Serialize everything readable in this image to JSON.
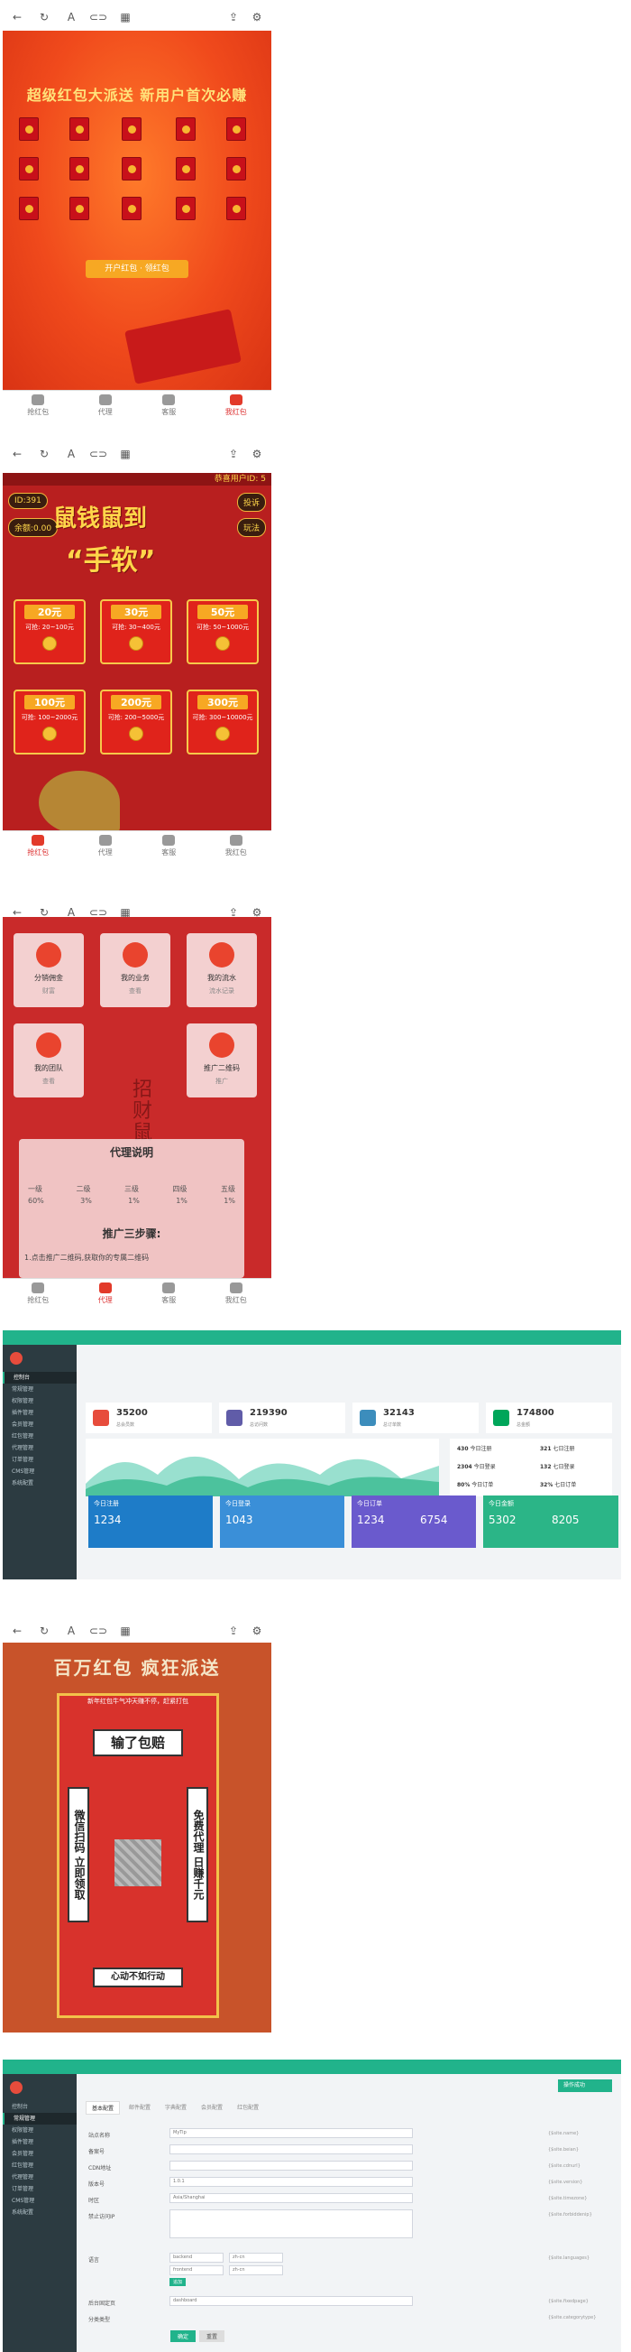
{
  "screen1": {
    "headline": "超级红包大派送 新用户首次必赚",
    "cta": "开户红包 · 领红包",
    "tabs": [
      "抢红包",
      "代理",
      "客服",
      "我红包"
    ]
  },
  "screen2": {
    "user_id": "ID:391",
    "balance": "余额:0.00",
    "notice": "恭喜用户ID: 5",
    "top_right_1": "投诉",
    "top_right_2": "玩法",
    "banner_title": "鼠钱鼠到",
    "banner_sub": "“手软”",
    "prizes": [
      {
        "amount": "20元",
        "range": "可抢: 20~100元"
      },
      {
        "amount": "30元",
        "range": "可抢: 30~400元"
      },
      {
        "amount": "50元",
        "range": "可抢: 50~1000元"
      },
      {
        "amount": "100元",
        "range": "可抢: 100~2000元"
      },
      {
        "amount": "200元",
        "range": "可抢: 200~5000元"
      },
      {
        "amount": "300元",
        "range": "可抢: 300~10000元"
      }
    ],
    "tabs": [
      "抢红包",
      "代理",
      "客服",
      "我红包"
    ]
  },
  "screen3": {
    "menu": [
      {
        "title": "分销佣金",
        "sub": "财富"
      },
      {
        "title": "我的业务",
        "sub": "查看"
      },
      {
        "title": "我的流水",
        "sub": "流水记录"
      },
      {
        "title": "我的团队",
        "sub": "查看"
      },
      {
        "title": "推广二维码",
        "sub": "推广"
      }
    ],
    "side_chars": "招财鼠",
    "agent_title": "代理说明",
    "levels": [
      "一级",
      "二级",
      "三级",
      "四级",
      "五级"
    ],
    "rates": [
      "60%",
      "3%",
      "1%",
      "1%",
      "1%"
    ],
    "steps_title": "推广三步骤:",
    "step1": "1.点击推广二维码,获取你的专属二维码",
    "tabs": [
      "抢红包",
      "代理",
      "客服",
      "我红包"
    ]
  },
  "dashboard": {
    "stats": [
      {
        "value": "35200",
        "label": "总会员数",
        "color": "#e74c3c"
      },
      {
        "value": "219390",
        "label": "总访问数",
        "color": "#605ca8"
      },
      {
        "value": "32143",
        "label": "总订单数",
        "color": "#3c8dbc"
      },
      {
        "value": "174800",
        "label": "总金额",
        "color": "#00a65a"
      }
    ],
    "side_stats": [
      {
        "value": "430",
        "label": "今日注册"
      },
      {
        "value": "2304",
        "label": "今日登录"
      },
      {
        "value": "80%",
        "label": "今日订单"
      },
      {
        "value": "321",
        "label": "七日注册"
      },
      {
        "value": "132",
        "label": "七日登录"
      },
      {
        "value": "32%",
        "label": "七日订单"
      }
    ],
    "kpis": [
      {
        "label": "今日注册",
        "value": "1234",
        "color": "#1e7cc8"
      },
      {
        "label": "今日登录",
        "value": "1043",
        "color": "#3a8fd8"
      },
      {
        "label": "今日订单",
        "value": "1234",
        "value2": "6754",
        "color": "#6a5acd"
      },
      {
        "label": "今日金额",
        "value": "5302",
        "value2": "8205",
        "color": "#2bb587"
      }
    ],
    "sidebar": [
      "控制台",
      "常规管理",
      "权限管理",
      "插件管理",
      "会员管理",
      "红包管理",
      "代理管理",
      "订单管理",
      "CMS管理",
      "系统配置"
    ]
  },
  "poster": {
    "title": "百万红包 疯狂派送",
    "banner_top": "新年红包牛气冲天赚不停，赶紧打包",
    "sign1": "输了包赔",
    "left_text": "微信扫码 立即领取",
    "right_text": "免费代理 日赚千元",
    "bottom": "心动不如行动"
  },
  "form": {
    "tab_active": "基本配置",
    "tabs": [
      "基本配置",
      "邮件配置",
      "字典配置",
      "会员配置",
      "红包配置"
    ],
    "success": "操作成功",
    "fields": [
      {
        "label": "站点名称",
        "value": "MyTip",
        "hint": "{$site.name}"
      },
      {
        "label": "备案号",
        "value": "",
        "hint": "{$site.beian}"
      },
      {
        "label": "CDN地址",
        "value": "",
        "hint": "{$site.cdnurl}"
      },
      {
        "label": "版本号",
        "value": "1.0.1",
        "hint": "{$site.version}"
      },
      {
        "label": "时区",
        "value": "Asia/Shanghai",
        "hint": "{$site.timezone}"
      },
      {
        "label": "禁止访问IP",
        "value": "",
        "hint": "{$site.forbiddenip}"
      }
    ],
    "lang_label": "语言",
    "lang_hint": "{$site.languages}",
    "lang_rows": [
      {
        "key": "backend",
        "value": "zh-cn"
      },
      {
        "key": "frontend",
        "value": "zh-cn"
      }
    ],
    "add_label": "追加",
    "fixed_label": "后台固定页",
    "fixed_value": "dashboard",
    "fixed_hint": "{$site.fixedpage}",
    "cat_label": "分类类型",
    "cat_hint": "{$site.categorytype}",
    "btn_confirm": "确定",
    "btn_reset": "重置"
  }
}
